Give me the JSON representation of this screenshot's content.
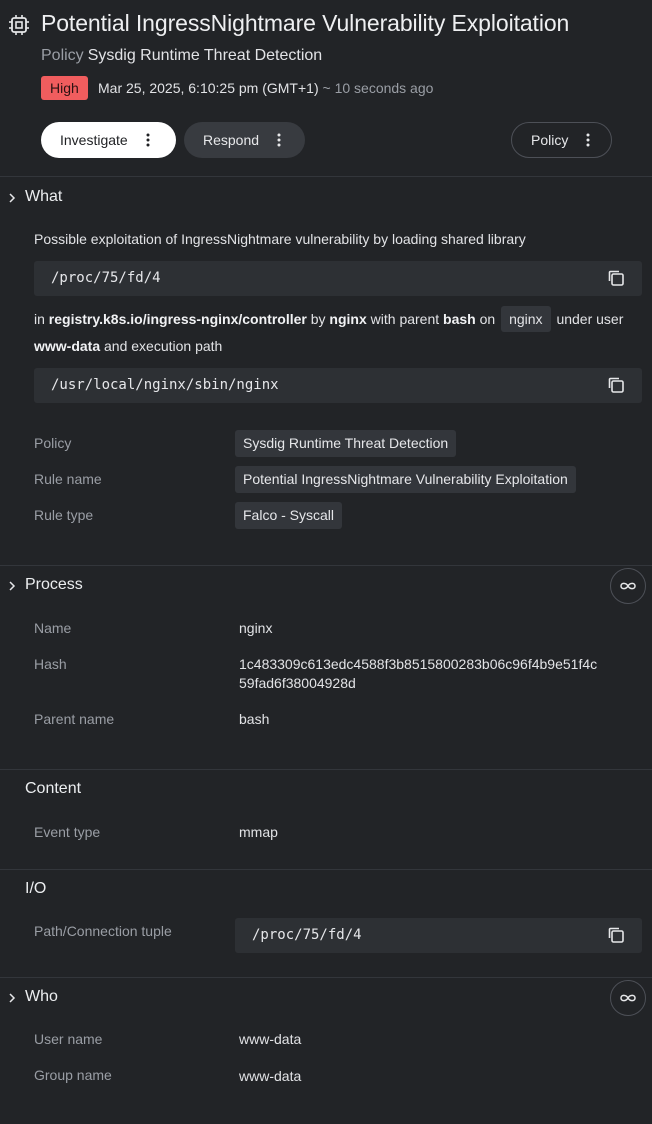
{
  "header": {
    "title": "Potential IngressNightmare Vulnerability Exploitation",
    "policy_label": "Policy",
    "policy_value": "Sysdig Runtime Threat Detection",
    "severity": "High",
    "timestamp": "Mar 25, 2025, 6:10:25 pm (GMT+1)",
    "relative_time": "~ 10 seconds ago",
    "colors": {
      "severity_high": "#f05d5e",
      "background": "#222427"
    }
  },
  "actions": {
    "investigate_label": "Investigate",
    "respond_label": "Respond",
    "policy_label": "Policy"
  },
  "what": {
    "title": "What",
    "description": "Possible exploitation of IngressNightmare vulnerability by loading shared library",
    "code1": "/proc/75/fd/4",
    "sentence": {
      "in": "in",
      "image": "registry.k8s.io/ingress-nginx/controller",
      "by": "by",
      "process": "nginx",
      "with_parent": "with parent",
      "parent": "bash",
      "on": "on",
      "host": "nginx",
      "under_user": "under user",
      "user": "www-data",
      "and_path": "and execution path"
    },
    "code2": "/usr/local/nginx/sbin/nginx",
    "fields": {
      "policy_label": "Policy",
      "policy_value": "Sysdig Runtime Threat Detection",
      "rule_name_label": "Rule name",
      "rule_name_value": "Potential IngressNightmare Vulnerability Exploitation",
      "rule_type_label": "Rule type",
      "rule_type_value": "Falco - Syscall"
    }
  },
  "process": {
    "title": "Process",
    "name_label": "Name",
    "name_value": "nginx",
    "hash_label": "Hash",
    "hash_line1": "1c483309c613edc4588f3b8515800283b06c96f4b9e51f4c",
    "hash_line2": "59fad6f38004928d",
    "parent_label": "Parent name",
    "parent_value": "bash"
  },
  "content": {
    "title": "Content",
    "event_type_label": "Event type",
    "event_type_value": "mmap"
  },
  "io": {
    "title": "I/O",
    "path_label": "Path/Connection tuple",
    "path_value": "/proc/75/fd/4"
  },
  "who": {
    "title": "Who",
    "user_label": "User name",
    "user_value": "www-data",
    "group_label": "Group name",
    "group_value": "www-data"
  },
  "icons": {
    "title": "chip-icon",
    "kebab": "kebab-icon",
    "copy": "copy-icon",
    "chevron": "chevron-right-icon",
    "topology": "infinity-icon"
  }
}
